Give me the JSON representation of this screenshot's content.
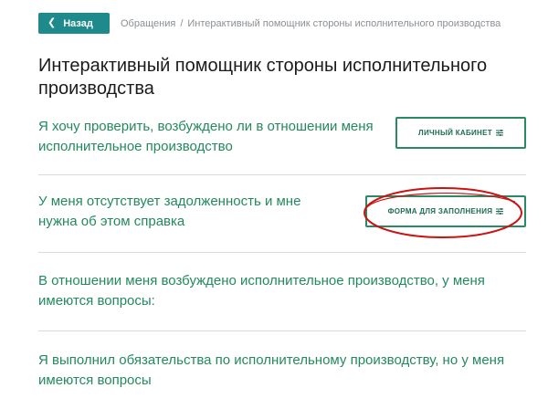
{
  "header": {
    "back_label": "Назад",
    "breadcrumb": [
      "Обращения",
      "Интерактивный помощник стороны исполнительного производства"
    ],
    "breadcrumb_separator": "/"
  },
  "title": "Интерактивный помощник стороны исполнительного производства",
  "rows": [
    {
      "text": "Я хочу проверить, возбуждено ли в отношении меня исполнительное производство",
      "button_label": "ЛИЧНЫЙ КАБИНЕТ"
    },
    {
      "text": "У меня отсутствует задолженность и мне нужна об этом справка",
      "button_label": "ФОРМА ДЛЯ ЗАПОЛНЕНИЯ"
    },
    {
      "text": "В отношении меня возбуждено исполнительное производство, у меня имеются вопросы:"
    },
    {
      "text": "Я выполнил обязательства по исполнительному производству, но у меня имеются вопросы"
    }
  ],
  "colors": {
    "accent": "#1e8a8c",
    "text_green": "#228a5e",
    "button_border": "#2a8a63",
    "highlight_ellipse": "#cc1111"
  },
  "icons": {
    "back": "chevron-left-icon",
    "settings": "sliders-icon",
    "highlight": "red-ellipse-annotation"
  }
}
